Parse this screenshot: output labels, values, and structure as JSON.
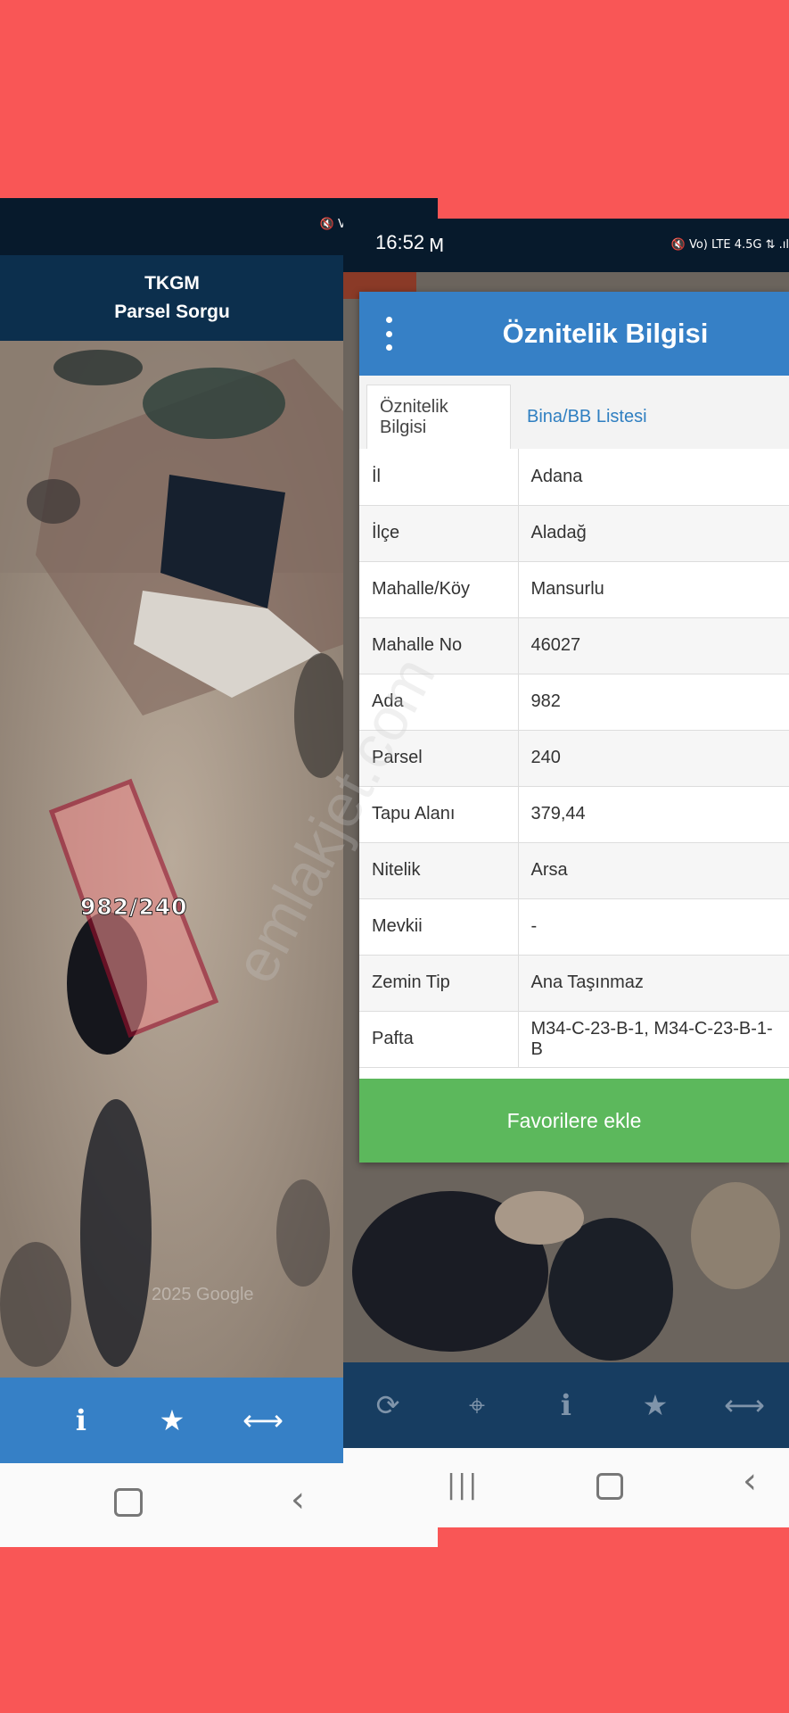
{
  "left": {
    "status_icons": "🔇 Vo) LTE 4.5G ⇅ .ıl",
    "header_title": "TKGM",
    "header_subtitle": "Parsel Sorgu",
    "parcel_label": "982/240",
    "watermark": "2025 Google"
  },
  "right": {
    "time": "16:52",
    "status_icons": "🔇 Vo) LTE 4.5G ⇅ .ıl",
    "dialog_title": "Öznitelik Bilgisi",
    "tabs": [
      {
        "label": "Öznitelik Bilgisi"
      },
      {
        "label": "Bina/BB Listesi"
      }
    ],
    "rows": [
      {
        "key": "İl",
        "value": "Adana"
      },
      {
        "key": "İlçe",
        "value": "Aladağ"
      },
      {
        "key": "Mahalle/Köy",
        "value": "Mansurlu"
      },
      {
        "key": "Mahalle No",
        "value": "46027"
      },
      {
        "key": "Ada",
        "value": "982"
      },
      {
        "key": "Parsel",
        "value": "240"
      },
      {
        "key": "Tapu Alanı",
        "value": "379,44"
      },
      {
        "key": "Nitelik",
        "value": "Arsa"
      },
      {
        "key": "Mevkii",
        "value": "-"
      },
      {
        "key": "Zemin Tip",
        "value": "Ana Taşınmaz"
      },
      {
        "key": "Pafta",
        "value": "M34-C-23-B-1, M34-C-23-B-1-B"
      }
    ],
    "fav_button": "Favorilere ekle"
  },
  "overlay_watermark": "emlakjet.com",
  "colors": {
    "background": "#f95656",
    "header_blue": "#3680c6",
    "dark_navy": "#071a2c",
    "green": "#5cb85c"
  }
}
